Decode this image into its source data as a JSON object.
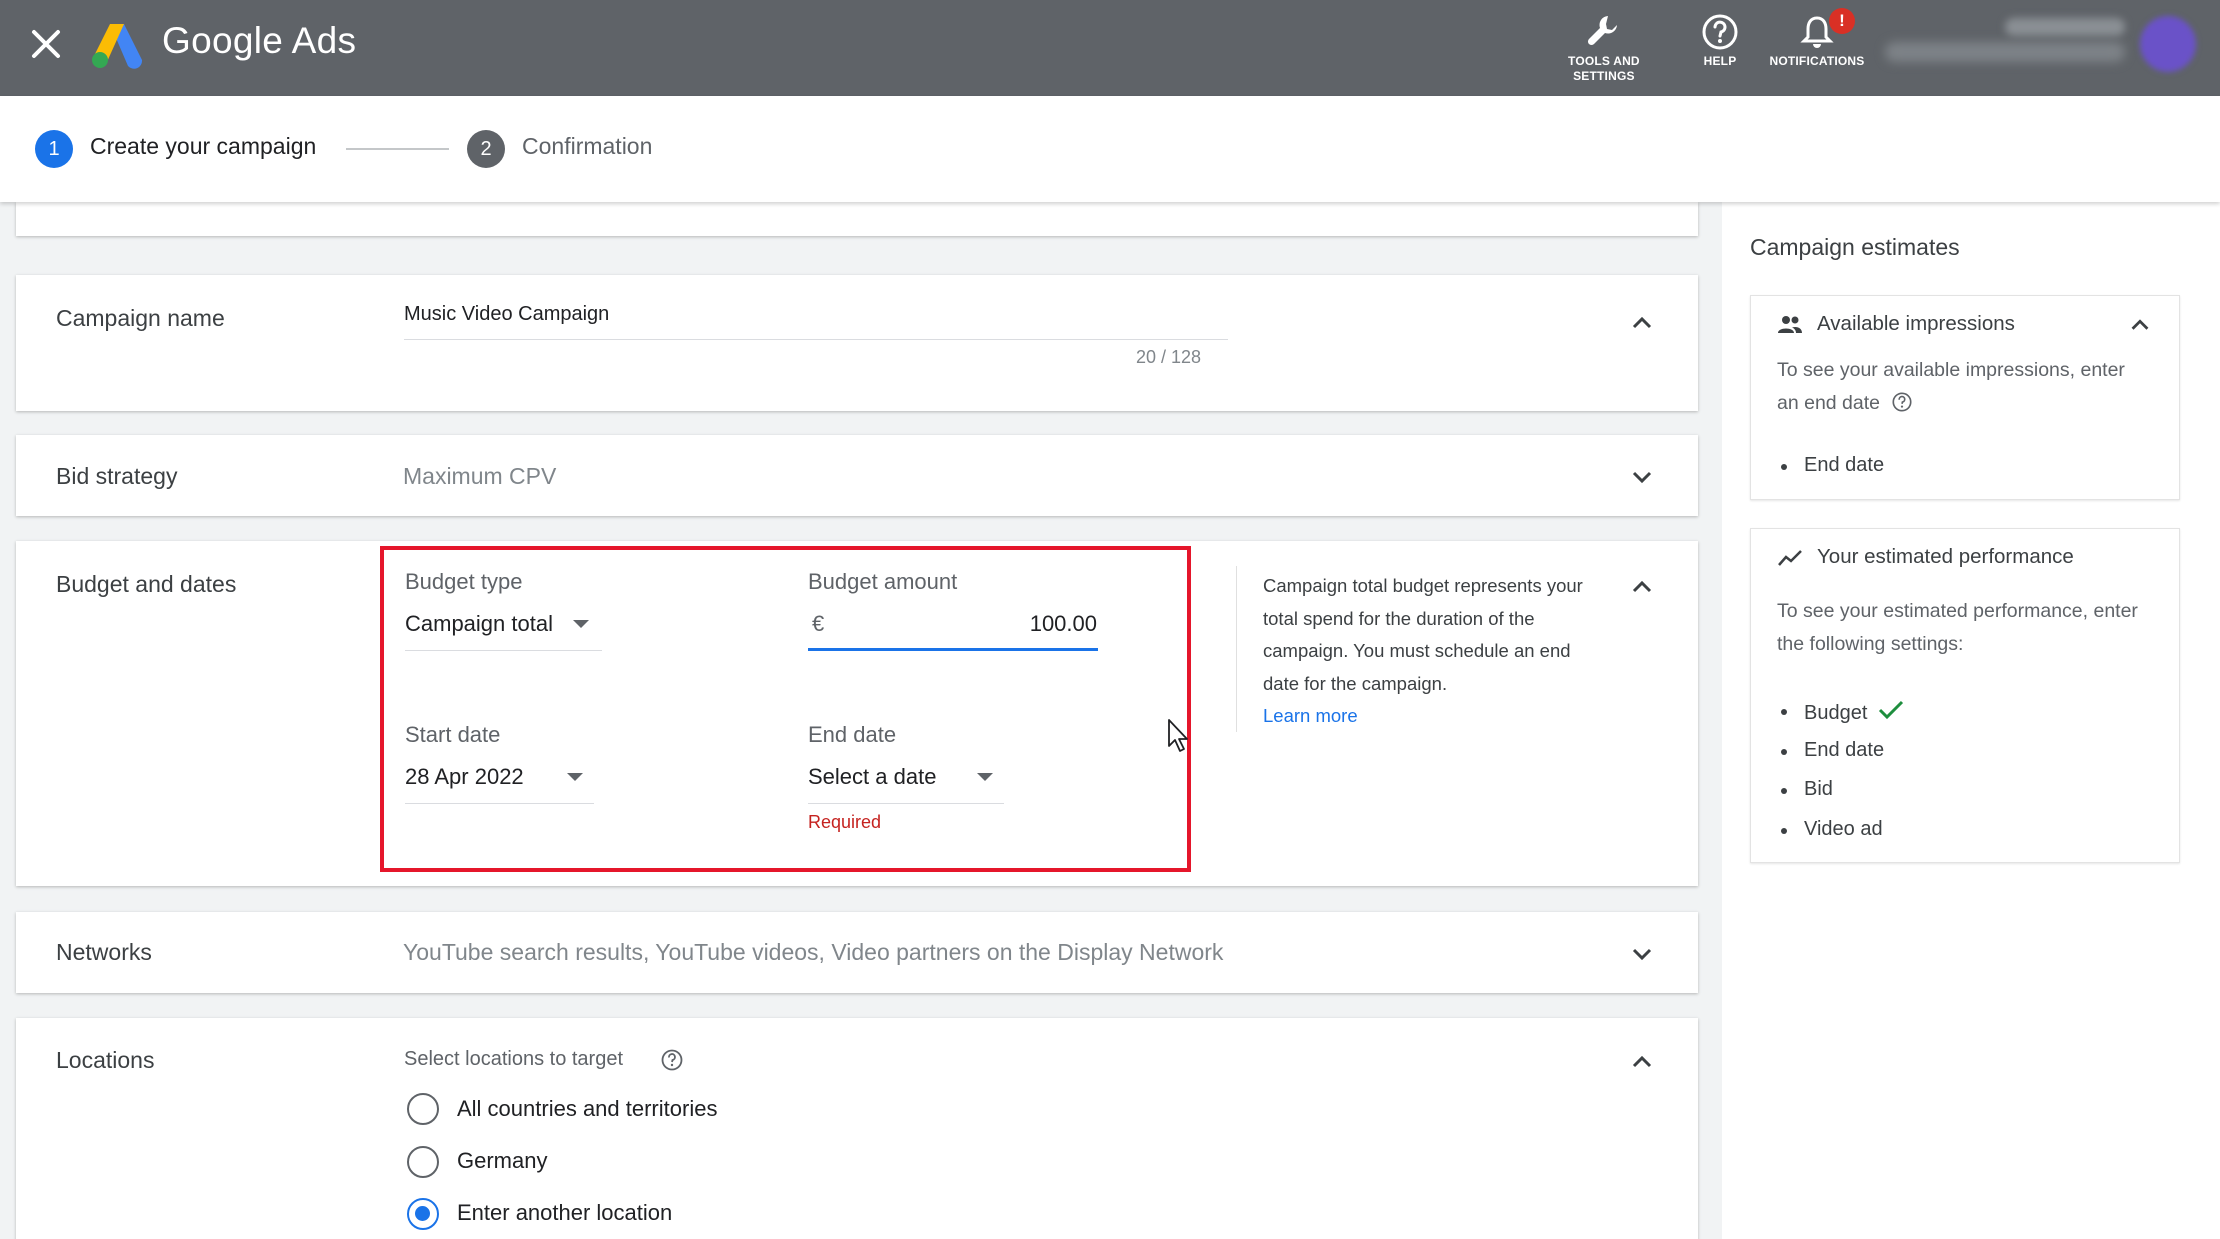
{
  "topbar": {
    "brand": "Google Ads",
    "tools_label_line1": "TOOLS AND",
    "tools_label_line2": "SETTINGS",
    "help_label": "HELP",
    "notifications_label": "NOTIFICATIONS",
    "notifications_badge": "!"
  },
  "stepper": {
    "step1_number": "1",
    "step1_label": "Create your campaign",
    "step2_number": "2",
    "step2_label": "Confirmation"
  },
  "campaign_name": {
    "title": "Campaign name",
    "value": "Music Video Campaign",
    "counter": "20 / 128"
  },
  "bid_strategy": {
    "title": "Bid strategy",
    "value": "Maximum CPV"
  },
  "budget": {
    "title": "Budget and dates",
    "budget_type_label": "Budget type",
    "budget_type_value": "Campaign total",
    "budget_amount_label": "Budget amount",
    "currency": "€",
    "amount": "100.00",
    "start_date_label": "Start date",
    "start_date_value": "28 Apr 2022",
    "end_date_label": "End date",
    "end_date_value": "Select a date",
    "end_date_error": "Required",
    "help_text": "Campaign total budget represents your total spend for the duration of the campaign. You must schedule an end date for the campaign.",
    "help_link": "Learn more"
  },
  "networks": {
    "title": "Networks",
    "value": "YouTube search results, YouTube videos, Video partners on the Display Network"
  },
  "locations": {
    "title": "Locations",
    "prompt": "Select locations to target",
    "options": [
      "All countries and territories",
      "Germany",
      "Enter another location"
    ],
    "selected_index": 2
  },
  "estimates": {
    "title": "Campaign estimates",
    "impressions_head": "Available impressions",
    "impressions_text": "To see your available impressions, enter an end date",
    "impressions_bullets": [
      "End date"
    ],
    "performance_head": "Your estimated performance",
    "performance_text": "To see your estimated performance, enter the following settings:",
    "performance_bullets": [
      "Budget",
      "End date",
      "Bid",
      "Video ad"
    ]
  },
  "colors": {
    "topbar": "#5f6368",
    "primary_blue": "#1a73e8",
    "highlight_red": "#e5162b",
    "error_red": "#c5221f",
    "check_green": "#1e8e3e"
  }
}
